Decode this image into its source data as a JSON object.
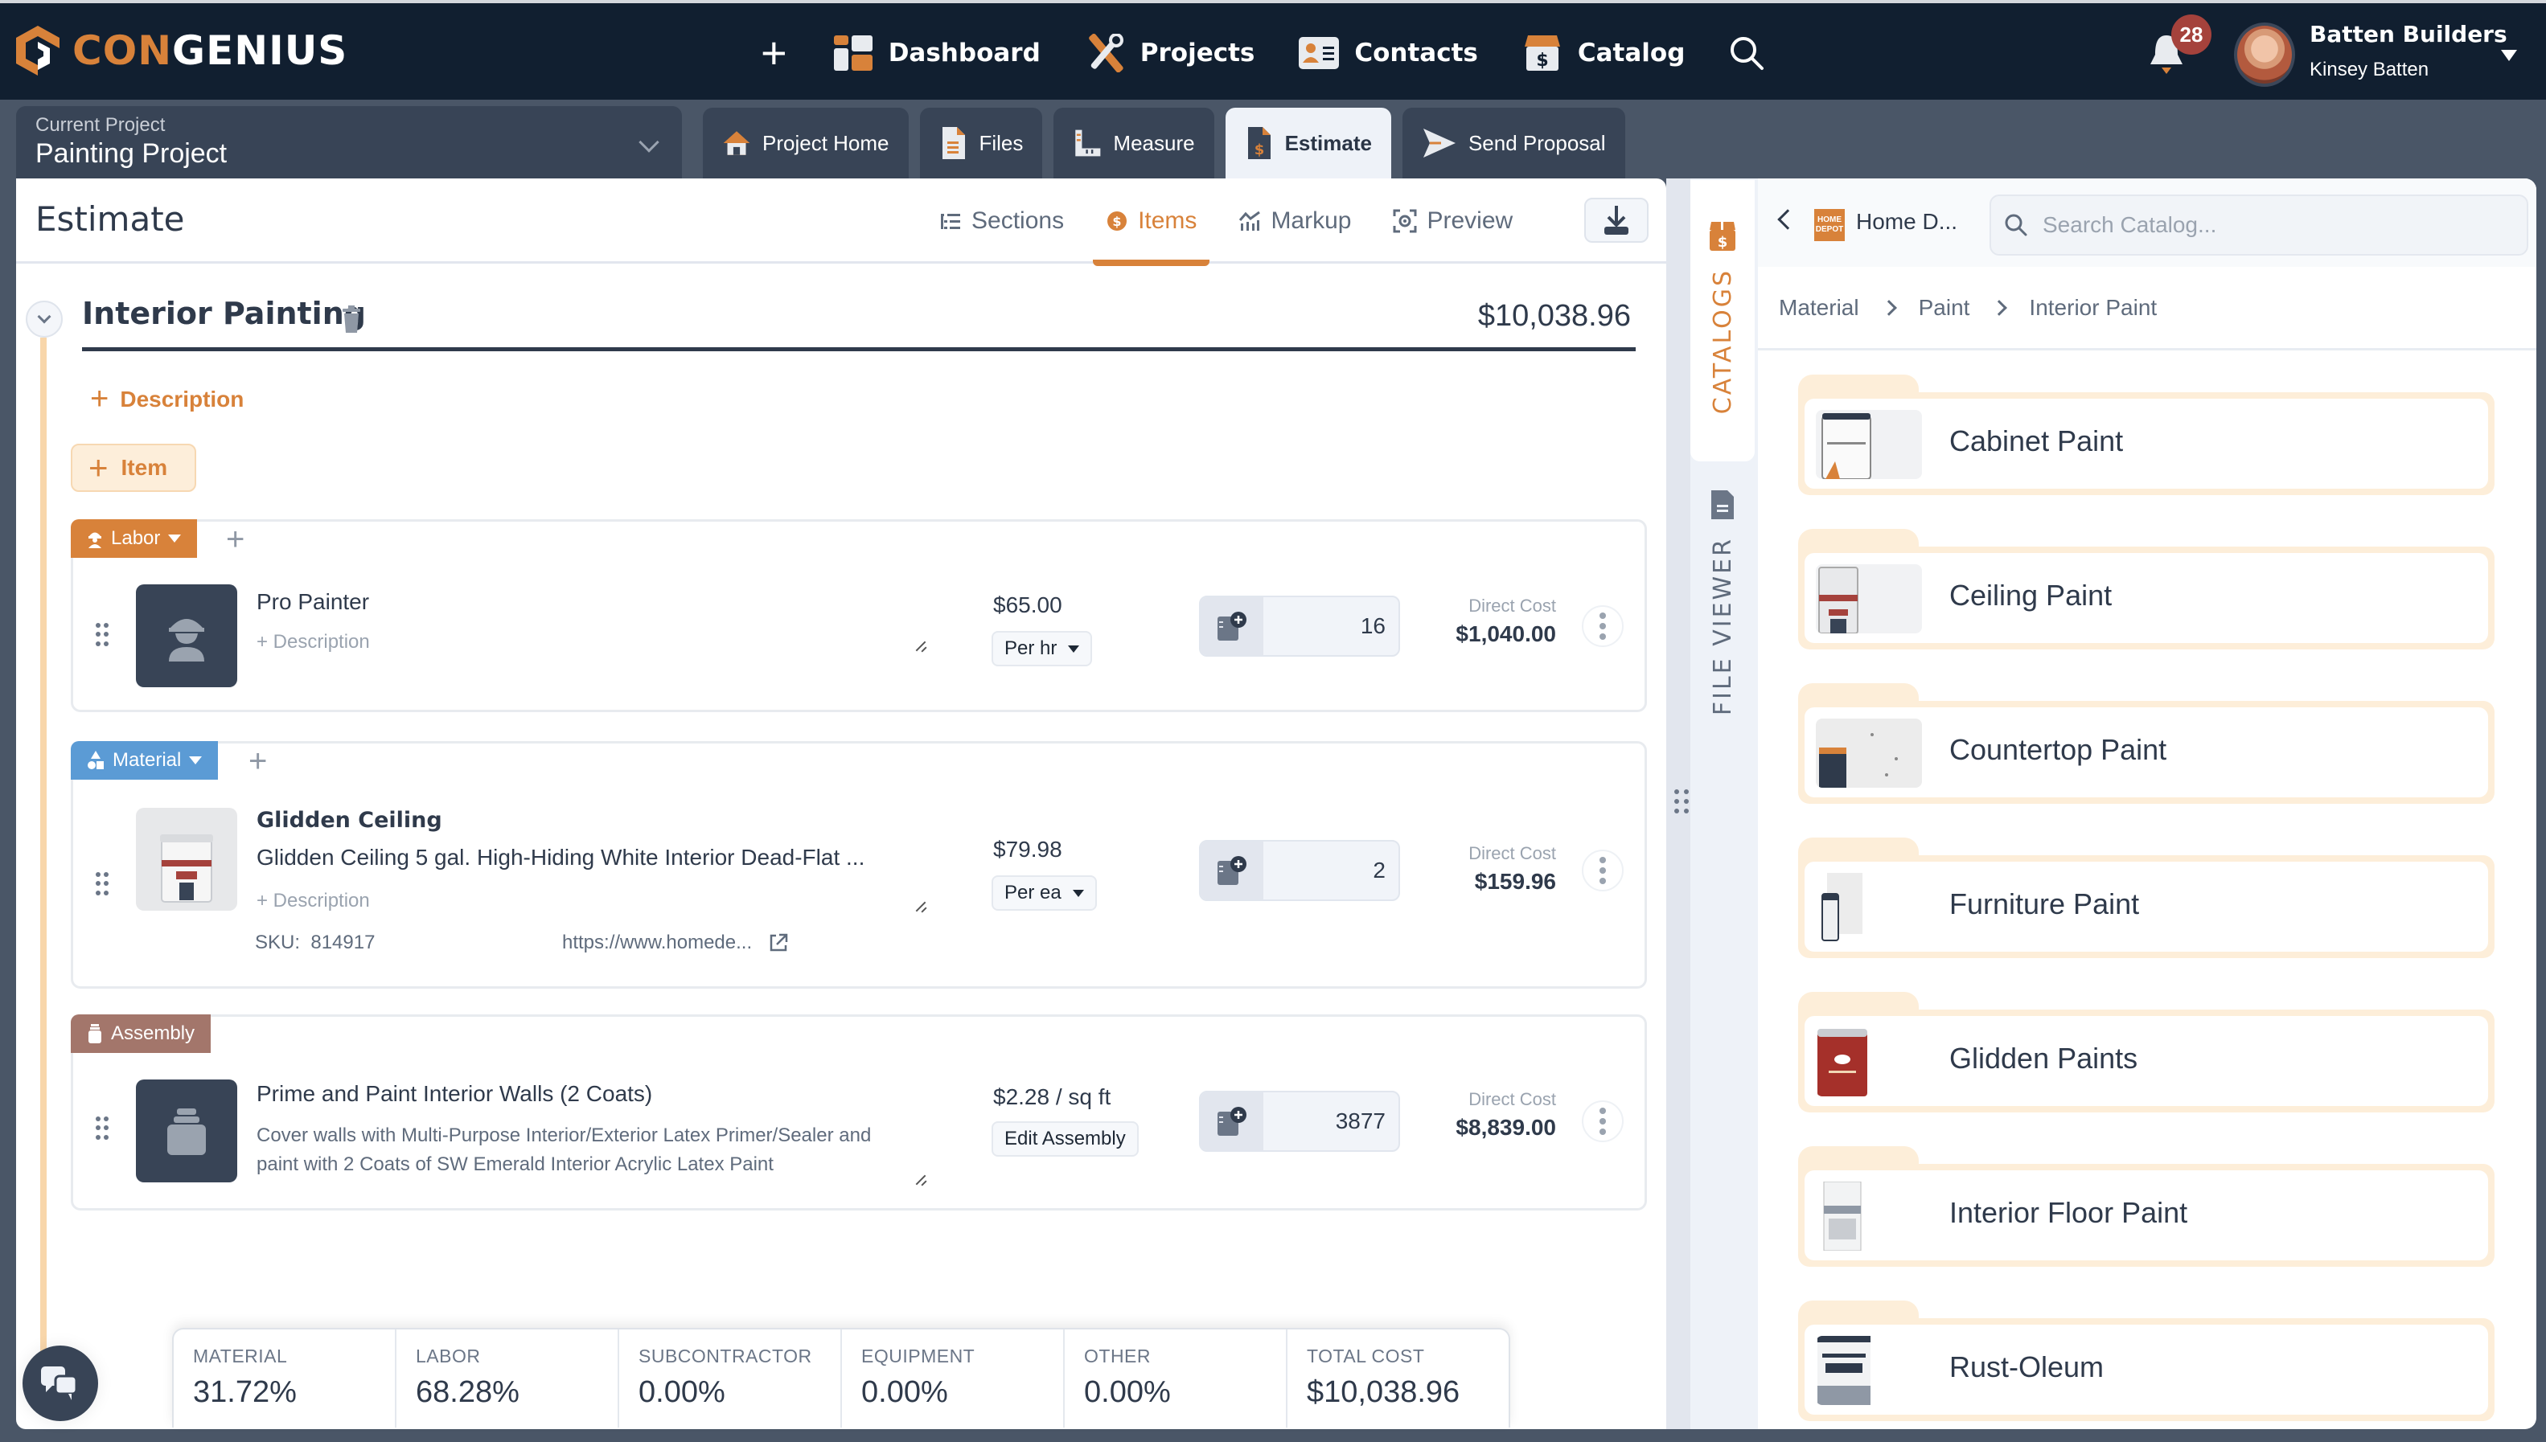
{
  "app": {
    "brand_prefix": "CON",
    "brand_suffix": "GENIUS",
    "accent_color": "#d8823a",
    "header_bg": "#111f30"
  },
  "nav": {
    "items": [
      {
        "label": "Dashboard",
        "icon": "dashboard-icon"
      },
      {
        "label": "Projects",
        "icon": "tools-icon"
      },
      {
        "label": "Contacts",
        "icon": "contact-card-icon"
      },
      {
        "label": "Catalog",
        "icon": "catalog-box-icon"
      }
    ],
    "notifications_count": "28",
    "user": {
      "company": "Batten Builders",
      "name": "Kinsey Batten"
    }
  },
  "project": {
    "label": "Current Project",
    "name": "Painting Project",
    "tabs": [
      {
        "label": "Project Home",
        "active": false
      },
      {
        "label": "Files",
        "active": false
      },
      {
        "label": "Measure",
        "active": false
      },
      {
        "label": "Estimate",
        "active": true
      },
      {
        "label": "Send Proposal",
        "active": false
      }
    ]
  },
  "estimate": {
    "title": "Estimate",
    "tabs": [
      {
        "label": "Sections",
        "active": false
      },
      {
        "label": "Items",
        "active": true
      },
      {
        "label": "Markup",
        "active": false
      },
      {
        "label": "Preview",
        "active": false
      }
    ],
    "section": {
      "title": "Interior Painting",
      "total": "$10,038.96",
      "add_description": "Description",
      "add_item": "Item"
    },
    "items": [
      {
        "type": "Labor",
        "type_color": "#d8823a",
        "name": "Pro Painter",
        "description_placeholder": "+ Description",
        "price": "$65.00",
        "unit": "Per hr",
        "quantity": "16",
        "direct_cost_label": "Direct Cost",
        "direct_cost": "$1,040.00"
      },
      {
        "type": "Material",
        "type_color": "#5b9bd5",
        "name": "Glidden Ceiling",
        "subtitle": "Glidden Ceiling 5 gal. High-Hiding White Interior Dead-Flat ...",
        "description_placeholder": "+ Description",
        "sku_label": "SKU:",
        "sku": "814917",
        "url": "https://www.homede...",
        "price": "$79.98",
        "unit": "Per ea",
        "quantity": "2",
        "direct_cost_label": "Direct Cost",
        "direct_cost": "$159.96"
      },
      {
        "type": "Assembly",
        "type_color": "#a3766b",
        "name": "Prime and Paint Interior Walls (2 Coats)",
        "description": "Cover walls with Multi-Purpose Interior/Exterior Latex Primer/Sealer and paint with 2 Coats of SW Emerald Interior Acrylic Latex Paint",
        "price": "$2.28 / sq ft",
        "edit_label": "Edit Assembly",
        "quantity": "3877",
        "direct_cost_label": "Direct Cost",
        "direct_cost": "$8,839.00"
      }
    ],
    "summary": [
      {
        "label": "MATERIAL",
        "value": "31.72%"
      },
      {
        "label": "LABOR",
        "value": "68.28%"
      },
      {
        "label": "SUBCONTRACTOR",
        "value": "0.00%"
      },
      {
        "label": "EQUIPMENT",
        "value": "0.00%"
      },
      {
        "label": "OTHER",
        "value": "0.00%"
      },
      {
        "label": "TOTAL COST",
        "value": "$10,038.96"
      }
    ]
  },
  "side_tabs": [
    {
      "label": "CATALOGS",
      "active": true
    },
    {
      "label": "FILE VIEWER",
      "active": false
    }
  ],
  "catalog": {
    "vendor_logo_text": "HOME DEPOT",
    "vendor_name": "Home D...",
    "search_placeholder": "Search Catalog...",
    "breadcrumb": [
      "Material",
      "Paint",
      "Interior Paint"
    ],
    "folders": [
      {
        "name": "Cabinet Paint"
      },
      {
        "name": "Ceiling Paint"
      },
      {
        "name": "Countertop Paint"
      },
      {
        "name": "Furniture Paint"
      },
      {
        "name": "Glidden Paints"
      },
      {
        "name": "Interior Floor Paint"
      },
      {
        "name": "Rust-Oleum"
      }
    ]
  }
}
